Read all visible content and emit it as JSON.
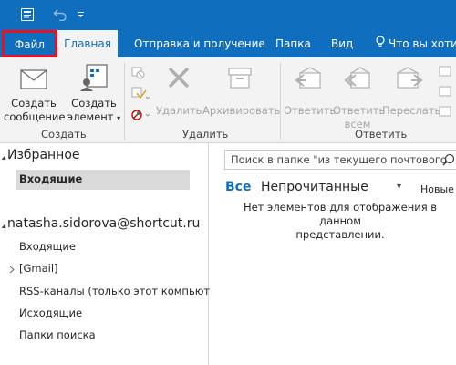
{
  "quick_access": {
    "send_receive_icon": "send-receive-icon",
    "undo_icon": "undo-icon",
    "customize_icon": "chevron-down-icon"
  },
  "tabs": {
    "file": "Файл",
    "home": "Главная",
    "send_receive": "Отправка и получение",
    "folder": "Папка",
    "view": "Вид",
    "tell_me": "Что вы хотите"
  },
  "ribbon": {
    "new_email_line1": "Создать",
    "new_email_line2": "сообщение",
    "new_items_line1": "Создать",
    "new_items_line2": "элемент",
    "group_new": "Создать",
    "delete": "Удалить",
    "archive": "Архивировать",
    "group_delete": "Удалить",
    "reply": "Ответить",
    "reply_all_line1": "Ответить",
    "reply_all_line2": "всем",
    "forward": "Переслать",
    "group_respond": "Ответить"
  },
  "nav": {
    "favorites_header": "Избранное",
    "favorites_inbox": "Входящие",
    "account": "natasha.sidorova@shortcut.ru",
    "folders": [
      "Входящие",
      "[Gmail]",
      "RSS-каналы (только этот компьют...",
      "Исходящие",
      "Папки поиска"
    ]
  },
  "pane": {
    "search_placeholder": "Поиск в папке \"из текущего почтового",
    "filter_all": "Все",
    "filter_unread": "Непрочитанные",
    "filter_new": "Новые",
    "empty_line1": "Нет элементов для отображения в данном",
    "empty_line2": "представлении."
  },
  "colors": {
    "accent": "#106ebe",
    "highlight_border": "#e81123"
  }
}
